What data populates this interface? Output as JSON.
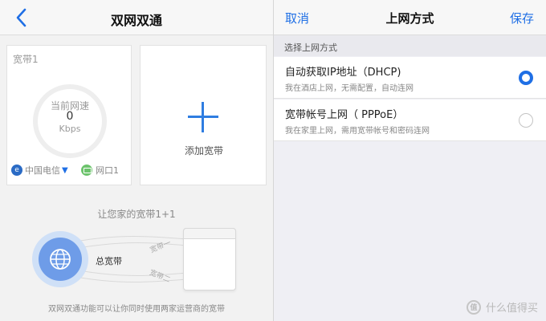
{
  "left": {
    "nav": {
      "title": "双网双通"
    },
    "broadband_card": {
      "label": "宽带1",
      "speed_label": "当前网速",
      "speed_value": "0",
      "speed_unit": "Kbps",
      "isp": "中国电信",
      "port": "网口1"
    },
    "add_card": {
      "label": "添加宽带"
    },
    "promo": {
      "title": "让您家的宽带1+1",
      "total_label": "总宽带",
      "wan1": "宽带一",
      "wan2": "宽带二",
      "description": "双网双通功能可以让你同时使用两家运营商的宽带"
    }
  },
  "right": {
    "nav": {
      "cancel": "取消",
      "title": "上网方式",
      "save": "保存"
    },
    "section_header": "选择上网方式",
    "options": [
      {
        "title": "自动获取IP地址（DHCP)",
        "subtitle": "我在酒店上网，无需配置，自动连网",
        "selected": true
      },
      {
        "title": "宽带帐号上网（ PPPoE）",
        "subtitle": "我在家里上网，需用宽带帐号和密码连网",
        "selected": false
      }
    ],
    "watermark": {
      "badge": "值",
      "text": "什么值得买"
    }
  },
  "colors": {
    "accent": "#1f6fe5",
    "gauge": "#eeeeee",
    "globe": "#6e9ce8"
  },
  "icons": [
    "back-chevron-icon",
    "plus-icon",
    "globe-icon",
    "isp-logo-icon",
    "ethernet-port-icon",
    "router-icon"
  ]
}
